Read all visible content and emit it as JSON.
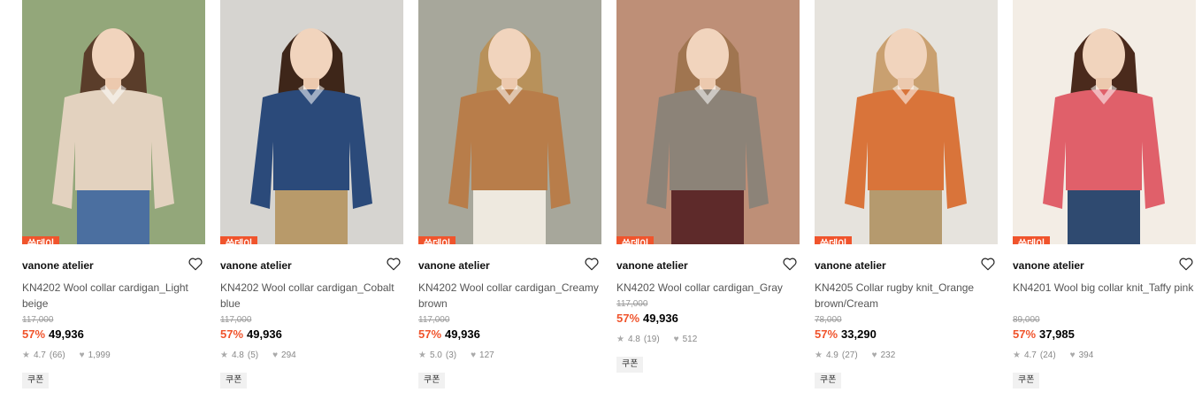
{
  "badge_label": "쓱데이",
  "coupon_label": "쿠폰",
  "products": [
    {
      "brand": "vanone atelier",
      "name": "KN4202 Wool collar cardigan_Light beige",
      "original_price": "117,000",
      "discount": "57%",
      "price": "49,936",
      "rating": "4.7",
      "reviews": "(66)",
      "likes": "1,999",
      "sweater_color": "#e3d2bf",
      "bg_color": "#6f8a4e",
      "bottom_color": "#4b6fa0",
      "hair_color": "#5a3d2a"
    },
    {
      "brand": "vanone atelier",
      "name": "KN4202 Wool collar cardigan_Cobalt blue",
      "original_price": "117,000",
      "discount": "57%",
      "price": "49,936",
      "rating": "4.8",
      "reviews": "(5)",
      "likes": "294",
      "sweater_color": "#2b4a7a",
      "bg_color": "#c9c6c0",
      "bottom_color": "#b89a6a",
      "hair_color": "#3e2619"
    },
    {
      "brand": "vanone atelier",
      "name": "KN4202 Wool collar cardigan_Creamy brown",
      "original_price": "117,000",
      "discount": "57%",
      "price": "49,936",
      "rating": "5.0",
      "reviews": "(3)",
      "likes": "127",
      "sweater_color": "#b87d4a",
      "bg_color": "#8a8a7a",
      "bottom_color": "#eee9df",
      "hair_color": "#b8915a"
    },
    {
      "brand": "vanone atelier",
      "name": "KN4202 Wool collar cardigan_Gray",
      "original_price": "117,000",
      "discount": "57%",
      "price": "49,936",
      "rating": "4.8",
      "reviews": "(19)",
      "likes": "512",
      "sweater_color": "#8c8378",
      "bg_color": "#a86a4a",
      "bottom_color": "#5e2a2a",
      "hair_color": "#a07550"
    },
    {
      "brand": "vanone atelier",
      "name": "KN4205 Collar rugby knit_Orange brown/Cream",
      "original_price": "78,000",
      "discount": "57%",
      "price": "33,290",
      "rating": "4.9",
      "reviews": "(27)",
      "likes": "232",
      "sweater_color": "#d9743a",
      "bg_color": "#dedad2",
      "bottom_color": "#b59a6e",
      "hair_color": "#c9a070"
    },
    {
      "brand": "vanone atelier",
      "name": "KN4201 Wool big collar knit_Taffy pink",
      "original_price": "89,000",
      "discount": "57%",
      "price": "37,985",
      "rating": "4.7",
      "reviews": "(24)",
      "likes": "394",
      "sweater_color": "#e0606a",
      "bg_color": "#efe7dd",
      "bottom_color": "#2f4a70",
      "hair_color": "#4a2a1c"
    }
  ]
}
